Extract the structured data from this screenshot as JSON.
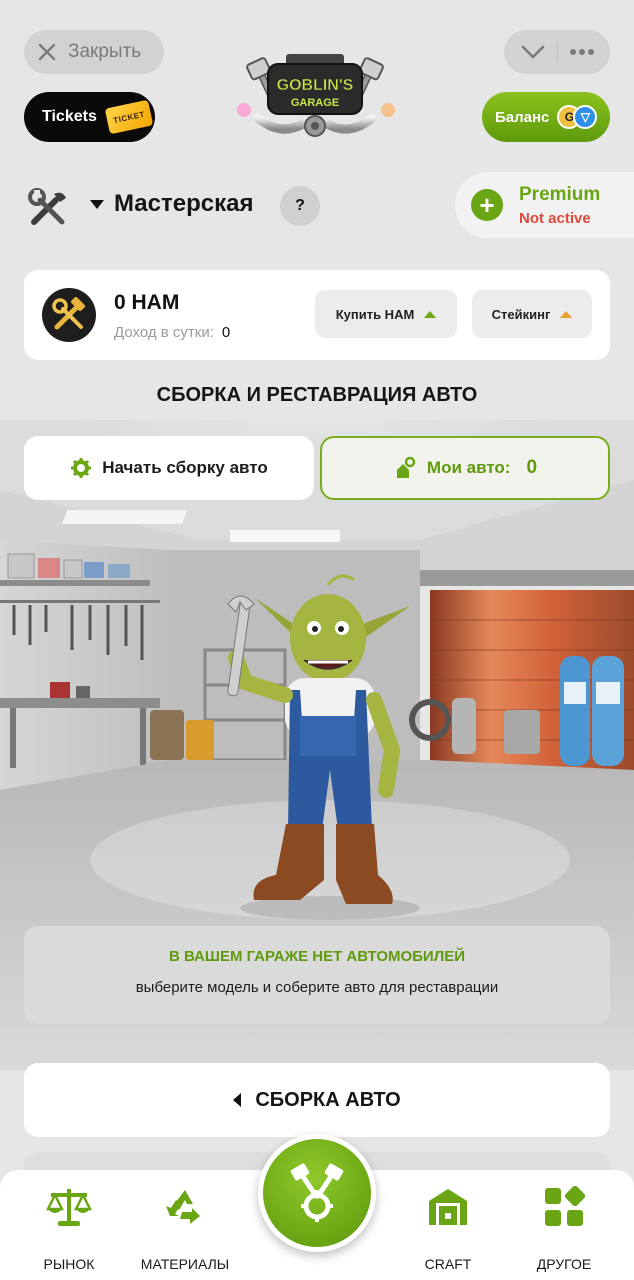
{
  "header": {
    "close_label": "Закрыть",
    "tickets_label": "Tickets",
    "ticket_badge": "TICKET",
    "logo_line1": "GOBLIN'S",
    "logo_line2": "GARAGE",
    "balance_label": "Баланс",
    "coin_g": "G",
    "coin_t": "▽"
  },
  "workshop": {
    "title": "Мастерская",
    "help": "?",
    "premium_title": "Premium",
    "premium_status": "Not active"
  },
  "ham": {
    "amount": "0 HAM",
    "income_label": "Доход в сутки:",
    "income_value": "0",
    "buy_label": "Купить HAM",
    "staking_label": "Стейкинг"
  },
  "assembly": {
    "heading": "СБОРКА И РЕСТАВРАЦИЯ АВТО",
    "start_label": "Начать сборку авто",
    "my_cars_label": "Мои авто:",
    "my_cars_count": "0",
    "empty_title": "В ВАШЕМ ГАРАЖЕ НЕТ АВТОМОБИЛЕЙ",
    "empty_sub": "выберите модель и соберите авто для реставрации",
    "build_label": "СБОРКА АВТО"
  },
  "nav": {
    "market": "РЫНОК",
    "materials": "МАТЕРИАЛЫ",
    "craft": "CRAFT",
    "other": "ДРУГОЕ"
  },
  "colors": {
    "accent": "#6aa513",
    "danger": "#e0483a",
    "background": "#e6e6e6"
  },
  "icons": {
    "close": "close-icon",
    "chevron": "chevron-down-icon",
    "more": "more-dots-icon",
    "tools": "crossed-tools-icon",
    "gear": "gear-icon",
    "key": "car-key-icon",
    "scales": "scales-icon",
    "recycle": "recycle-icon",
    "engine": "engine-pistons-icon",
    "craft": "craft-house-icon",
    "other": "grid-icon"
  }
}
